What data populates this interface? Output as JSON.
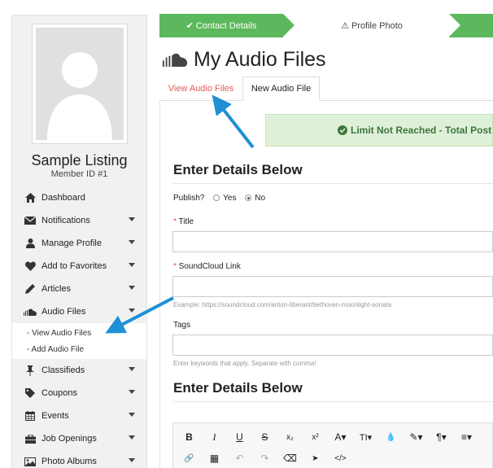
{
  "steps": [
    {
      "label": "Contact Details",
      "state": "complete"
    },
    {
      "label": "Profile Photo",
      "state": "current"
    }
  ],
  "profile": {
    "name": "Sample Listing",
    "member_id": "Member ID #1"
  },
  "sidebar": {
    "items": [
      {
        "label": "Dashboard",
        "icon": "home-icon",
        "caret": false
      },
      {
        "label": "Notifications",
        "icon": "envelope-icon",
        "caret": true
      },
      {
        "label": "Manage Profile",
        "icon": "user-icon",
        "caret": true
      },
      {
        "label": "Add to Favorites",
        "icon": "heart-icon",
        "caret": true
      },
      {
        "label": "Articles",
        "icon": "pencil-icon",
        "caret": true
      },
      {
        "label": "Audio Files",
        "icon": "soundcloud-icon",
        "caret": true
      },
      {
        "label": "Classifieds",
        "icon": "pin-icon",
        "caret": true
      },
      {
        "label": "Coupons",
        "icon": "tag-icon",
        "caret": true
      },
      {
        "label": "Events",
        "icon": "calendar-icon",
        "caret": true
      },
      {
        "label": "Job Openings",
        "icon": "briefcase-icon",
        "caret": true
      },
      {
        "label": "Photo Albums",
        "icon": "image-icon",
        "caret": true
      }
    ],
    "audio_sub_items": [
      "- View Audio Files",
      "- Add Audio File"
    ]
  },
  "page": {
    "title": "My Audio Files",
    "tabs": [
      "View Audio Files",
      "New Audio File"
    ],
    "alert": "Limit Not Reached - Total Post"
  },
  "form": {
    "section_title": "Enter Details Below",
    "publish_label": "Publish?",
    "publish_options": [
      "Yes",
      "No"
    ],
    "publish_selected": "No",
    "title_label": "Title",
    "soundcloud_label": "SoundCloud Link",
    "soundcloud_help": "Example: https://soundcloud.com/anton-liberant/bethoven-moonlight-sonata",
    "tags_label": "Tags",
    "tags_help": "Enter keywords that apply. Separate with comma!",
    "section_title_2": "Enter Details Below"
  },
  "toolbar": {
    "row1": [
      "B",
      "I",
      "U",
      "S",
      "x₂",
      "x²",
      "A▾",
      "TI▾",
      "💧",
      "✎▾",
      "¶▾",
      "≡▾"
    ],
    "row2": [
      "🔗",
      "▦",
      "↶",
      "↷",
      "⌫",
      "➤",
      "</>"
    ]
  },
  "colors": {
    "accent_green": "#5cb85c",
    "arrow_blue": "#1e90d6",
    "active_tab_red": "#e05a5a"
  }
}
